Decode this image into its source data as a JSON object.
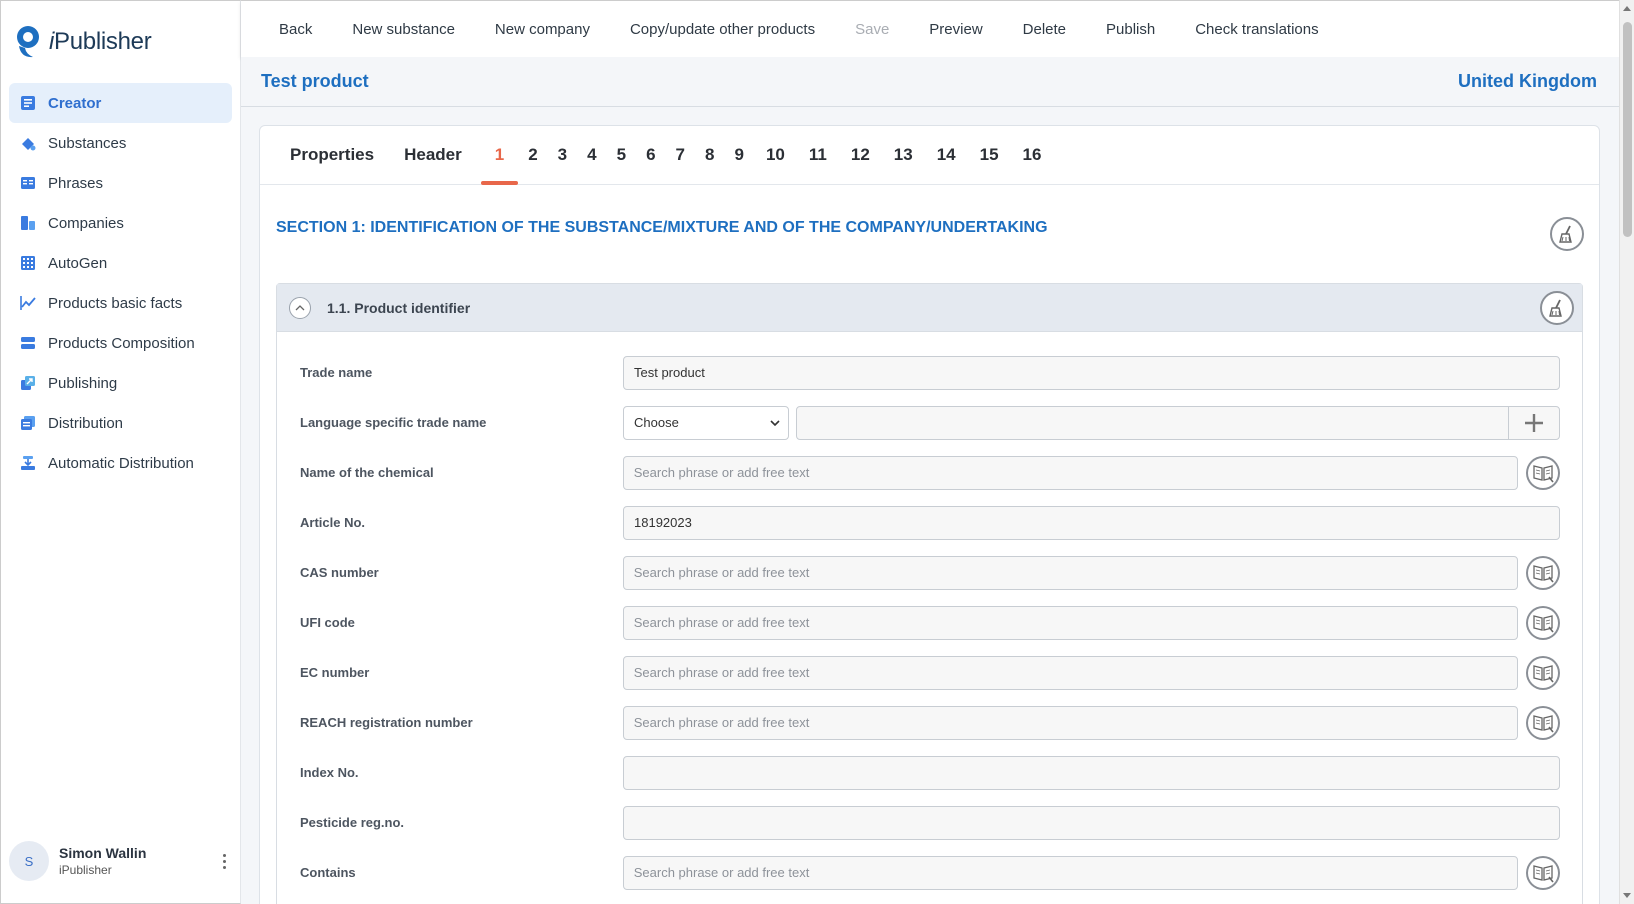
{
  "app": {
    "logo_text_prefix": "i",
    "logo_text_rest": "Publisher",
    "brand_color": "#1e6fc0",
    "accent_color": "#e8674a"
  },
  "sidebar": {
    "items": [
      {
        "label": "Creator",
        "icon": "creator-icon",
        "active": true
      },
      {
        "label": "Substances",
        "icon": "flask-icon"
      },
      {
        "label": "Phrases",
        "icon": "book-icon"
      },
      {
        "label": "Companies",
        "icon": "building-icon"
      },
      {
        "label": "AutoGen",
        "icon": "grid-icon"
      },
      {
        "label": "Products basic facts",
        "icon": "chart-icon"
      },
      {
        "label": "Products Composition",
        "icon": "layers-icon"
      },
      {
        "label": "Publishing",
        "icon": "publish-icon"
      },
      {
        "label": "Distribution",
        "icon": "distribution-icon"
      },
      {
        "label": "Automatic Distribution",
        "icon": "auto-distribution-icon"
      }
    ],
    "user": {
      "initial": "S",
      "name": "Simon Wallin",
      "org": "iPublisher"
    }
  },
  "toolbar": {
    "back": "Back",
    "new_substance": "New substance",
    "new_company": "New company",
    "copy_update": "Copy/update other products",
    "save": "Save",
    "preview": "Preview",
    "delete": "Delete",
    "publish": "Publish",
    "check_translations": "Check translations"
  },
  "titlebar": {
    "product": "Test product",
    "country": "United Kingdom"
  },
  "tabs": [
    "Properties",
    "Header",
    "1",
    "2",
    "3",
    "4",
    "5",
    "6",
    "7",
    "8",
    "9",
    "10",
    "11",
    "12",
    "13",
    "14",
    "15",
    "16"
  ],
  "active_tab": "1",
  "section": {
    "title": "SECTION 1: IDENTIFICATION OF THE SUBSTANCE/MIXTURE AND OF THE COMPANY/UNDERTAKING",
    "panel_title": "1.1. Product identifier"
  },
  "fields": {
    "trade_name": {
      "label": "Trade name",
      "value": "Test product"
    },
    "language_trade_name": {
      "label": "Language specific trade name",
      "select_value": "Choose"
    },
    "name_of_chemical": {
      "label": "Name of the chemical",
      "placeholder": "Search phrase or add free text"
    },
    "article_no": {
      "label": "Article No.",
      "value": "18192023"
    },
    "cas_number": {
      "label": "CAS number",
      "placeholder": "Search phrase or add free text"
    },
    "ufi_code": {
      "label": "UFI code",
      "placeholder": "Search phrase or add free text"
    },
    "ec_number": {
      "label": "EC number",
      "placeholder": "Search phrase or add free text"
    },
    "reach_number": {
      "label": "REACH registration number",
      "placeholder": "Search phrase or add free text"
    },
    "index_no": {
      "label": "Index No.",
      "value": ""
    },
    "pesticide_reg": {
      "label": "Pesticide reg.no.",
      "value": ""
    },
    "contains": {
      "label": "Contains",
      "placeholder": "Search phrase or add free text"
    }
  }
}
